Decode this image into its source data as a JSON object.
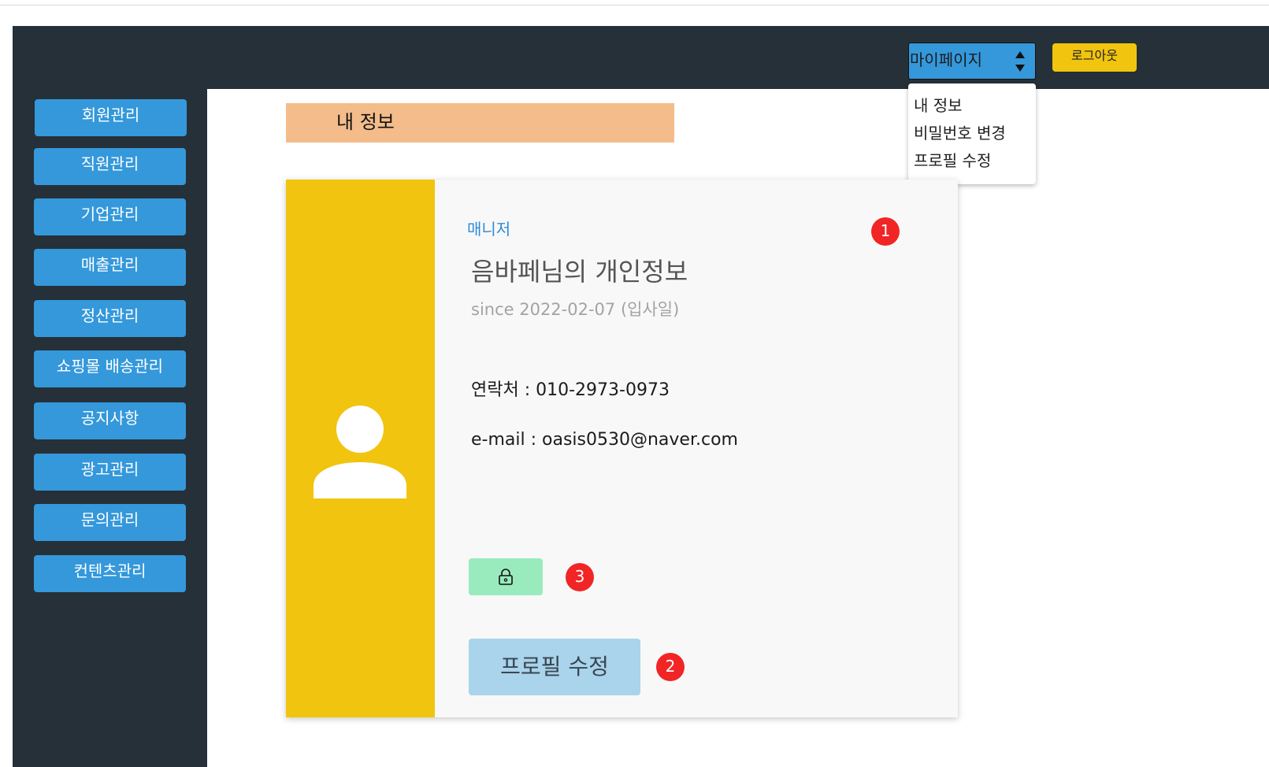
{
  "header": {
    "mypage_select": {
      "selected": "마이페이지"
    },
    "logout_label": "로그아웃"
  },
  "dropdown": {
    "items": [
      "내 정보",
      "비밀번호 변경",
      "프로필 수정"
    ]
  },
  "sidebar": {
    "items": [
      {
        "label": "회원관리"
      },
      {
        "label": "직원관리"
      },
      {
        "label": "기업관리"
      },
      {
        "label": "매출관리"
      },
      {
        "label": "정산관리"
      },
      {
        "label": "쇼핑몰 배송관리"
      },
      {
        "label": "공지사항"
      },
      {
        "label": "광고관리"
      },
      {
        "label": "문의관리"
      },
      {
        "label": "컨텐츠관리"
      }
    ]
  },
  "main": {
    "section_title": "내 정보",
    "card": {
      "role": "매니저",
      "title": "음바페님의 개인정보",
      "since": "since 2022-02-07 (입사일)",
      "contact": "연락처 : 010-2973-0973",
      "email": "e-mail : oasis0530@naver.com",
      "profile_edit_label": "프로필 수정"
    }
  },
  "badges": [
    "1",
    "2",
    "3"
  ],
  "colors": {
    "nav_bg": "#263038",
    "button_blue": "#3498db",
    "accent_yellow": "#f1c40f",
    "section_title_bg": "#f4bc8b",
    "lock_button_bg": "#99ebbd",
    "profile_button_bg": "#aad3ec",
    "badge_red": "#f12525",
    "role_blue": "#2e8bd6"
  },
  "icons": {
    "avatar": "user-silhouette-icon",
    "lock": "lock-icon",
    "select_arrows": "up-down-arrows-icon"
  }
}
